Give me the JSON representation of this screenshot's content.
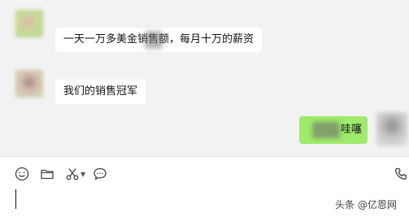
{
  "messages": [
    {
      "sender": "other",
      "text": "一天一万多美金销售额，每月十万的薪资"
    },
    {
      "sender": "other",
      "text": "我们的销售冠军"
    },
    {
      "sender": "self",
      "text": "哇噻"
    }
  ],
  "toolbar": {
    "icons": [
      "emoji-icon",
      "folder-icon",
      "scissors-icon",
      "chat-bubble-icon",
      "phone-icon"
    ]
  },
  "watermark": "头条 @亿恩网",
  "colors": {
    "chat_background": "#f2f2f2",
    "incoming_bubble": "#ffffff",
    "outgoing_bubble": "#9eea6a"
  }
}
